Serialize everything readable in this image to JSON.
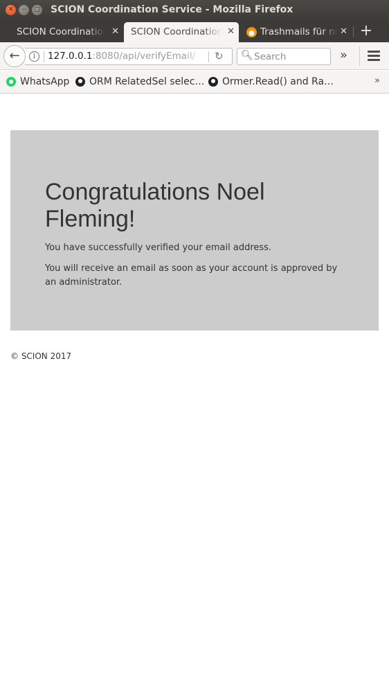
{
  "window": {
    "title": "SCION Coordination Service - Mozilla Firefox"
  },
  "tabs": [
    {
      "label": "SCION Coordination Service",
      "active": false
    },
    {
      "label": "SCION Coordination Service",
      "active": true
    },
    {
      "label": "Trashmails für nur...",
      "active": false
    }
  ],
  "navbar": {
    "url_host": "127.0.0.1",
    "url_rest": ":8080/api/verifyEmail/",
    "search_placeholder": "Search"
  },
  "bookmarks": [
    {
      "label": "WhatsApp",
      "icon": "whatsapp-icon"
    },
    {
      "label": "ORM RelatedSel selec…",
      "icon": "github-icon"
    },
    {
      "label": "Ormer.Read() and Ra…",
      "icon": "github-icon"
    }
  ],
  "page": {
    "headline": "Congratulations Noel Fleming!",
    "line1": "You have successfully verified your email address.",
    "line2": "You will receive an email as soon as your account is approved by an administrator.",
    "footer": "© SCION 2017"
  },
  "colors": {
    "titlebar": "#3c3b37",
    "panel": "#cccccc",
    "close_button": "#df4a16"
  }
}
